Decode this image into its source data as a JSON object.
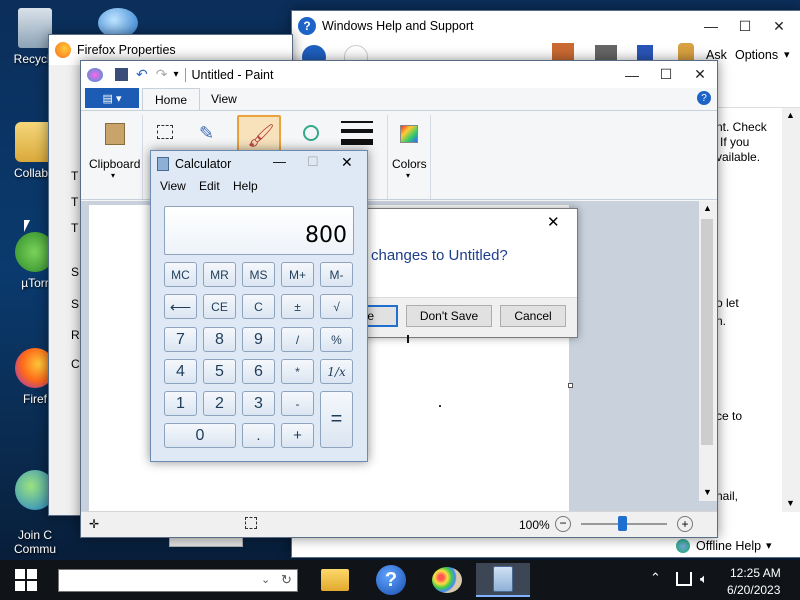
{
  "desktop": {
    "icons": [
      {
        "label": "Recycle"
      },
      {
        "label": ""
      },
      {
        "label": "CollabS"
      },
      {
        "label": "µTorr"
      },
      {
        "label": "Firef"
      },
      {
        "label": "Join C\nCommu"
      }
    ]
  },
  "help_window": {
    "title": "Windows Help and Support",
    "toolbar": {
      "ask": "Ask",
      "options": "Options"
    },
    "content_lines": [
      "nt. Check",
      "If you",
      "vailable.",
      "o let",
      "n.",
      "ce to",
      "nail,"
    ],
    "footer": {
      "offline_help": "Offline Help"
    }
  },
  "firefox_properties": {
    "title": "Firefox Properties",
    "letters": [
      "T",
      "T",
      "T",
      "S",
      "S",
      "R",
      "C"
    ]
  },
  "paint": {
    "title": "Untitled - Paint",
    "tabs": {
      "home": "Home",
      "view": "View"
    },
    "groups": {
      "clipboard": "Clipboard",
      "colors": "Colors"
    },
    "status": {
      "zoom": "100%"
    }
  },
  "dialog": {
    "message": "changes to Untitled?",
    "save": "ve",
    "dont_save": "Don't Save",
    "cancel": "Cancel"
  },
  "calculator": {
    "title": "Calculator",
    "menu": {
      "view": "View",
      "edit": "Edit",
      "help": "Help"
    },
    "display": "800",
    "keys": {
      "mc": "MC",
      "mr": "MR",
      "ms": "MS",
      "mplus": "M+",
      "mminus": "M-",
      "back": "⟵",
      "ce": "CE",
      "c": "C",
      "pm": "±",
      "sqrt": "√",
      "k7": "7",
      "k8": "8",
      "k9": "9",
      "div": "/",
      "pct": "%",
      "k4": "4",
      "k5": "5",
      "k6": "6",
      "mul": "*",
      "inv": "1/x",
      "k1": "1",
      "k2": "2",
      "k3": "3",
      "sub": "-",
      "eq": "=",
      "k0": "0",
      "dot": ".",
      "add": "+"
    }
  },
  "taskbar": {
    "clock_time": "12:25 AM",
    "clock_date": "6/20/2023"
  }
}
